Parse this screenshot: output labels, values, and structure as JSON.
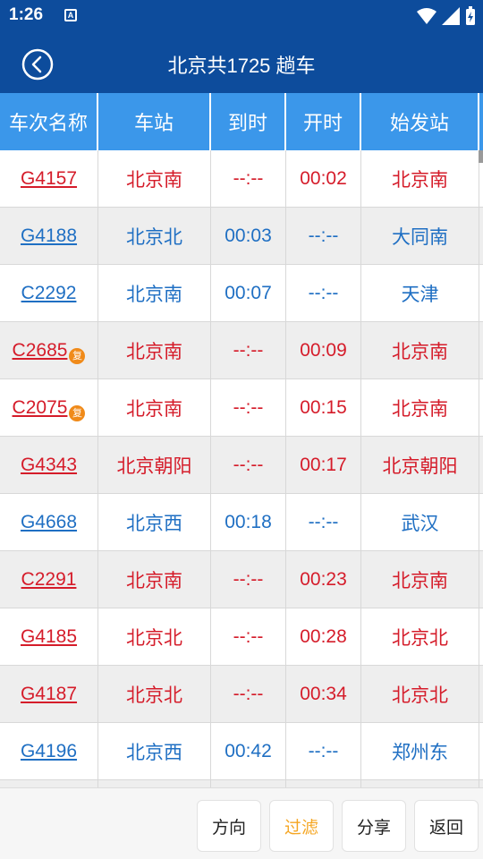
{
  "status_bar": {
    "time": "1:26",
    "notif_icon": "A"
  },
  "app_bar": {
    "title": "北京共1725 趟车"
  },
  "table": {
    "headers": [
      "车次名称",
      "车站",
      "到时",
      "开时",
      "始发站",
      ""
    ],
    "rows": [
      {
        "train": "G4157",
        "station": "北京南",
        "arrive": "--:--",
        "depart": "00:02",
        "origin": "北京南",
        "color": "red",
        "badge": ""
      },
      {
        "train": "G4188",
        "station": "北京北",
        "arrive": "00:03",
        "depart": "--:--",
        "origin": "大同南",
        "color": "blue",
        "badge": ""
      },
      {
        "train": "C2292",
        "station": "北京南",
        "arrive": "00:07",
        "depart": "--:--",
        "origin": "天津",
        "color": "blue",
        "badge": ""
      },
      {
        "train": "C2685",
        "station": "北京南",
        "arrive": "--:--",
        "depart": "00:09",
        "origin": "北京南",
        "color": "red",
        "badge": "复"
      },
      {
        "train": "C2075",
        "station": "北京南",
        "arrive": "--:--",
        "depart": "00:15",
        "origin": "北京南",
        "color": "red",
        "badge": "复"
      },
      {
        "train": "G4343",
        "station": "北京朝阳",
        "arrive": "--:--",
        "depart": "00:17",
        "origin": "北京朝阳",
        "color": "red",
        "badge": ""
      },
      {
        "train": "G4668",
        "station": "北京西",
        "arrive": "00:18",
        "depart": "--:--",
        "origin": "武汉",
        "color": "blue",
        "badge": ""
      },
      {
        "train": "C2291",
        "station": "北京南",
        "arrive": "--:--",
        "depart": "00:23",
        "origin": "北京南",
        "color": "red",
        "badge": ""
      },
      {
        "train": "G4185",
        "station": "北京北",
        "arrive": "--:--",
        "depart": "00:28",
        "origin": "北京北",
        "color": "red",
        "badge": ""
      },
      {
        "train": "G4187",
        "station": "北京北",
        "arrive": "--:--",
        "depart": "00:34",
        "origin": "北京北",
        "color": "red",
        "badge": ""
      },
      {
        "train": "G4196",
        "station": "北京西",
        "arrive": "00:42",
        "depart": "--:--",
        "origin": "郑州东",
        "color": "blue",
        "badge": ""
      },
      {
        "train": "",
        "station": "",
        "arrive": "",
        "depart": "",
        "origin": "",
        "color": "blue",
        "badge": ""
      }
    ]
  },
  "bottom_bar": {
    "direction": "方向",
    "filter": "过滤",
    "share": "分享",
    "back": "返回"
  },
  "colors": {
    "primary": "#0d4c9c",
    "header": "#3b97ea",
    "red": "#d51c2a",
    "blue": "#1f6fc3",
    "active": "#f5a623",
    "badge": "#f08a19"
  }
}
